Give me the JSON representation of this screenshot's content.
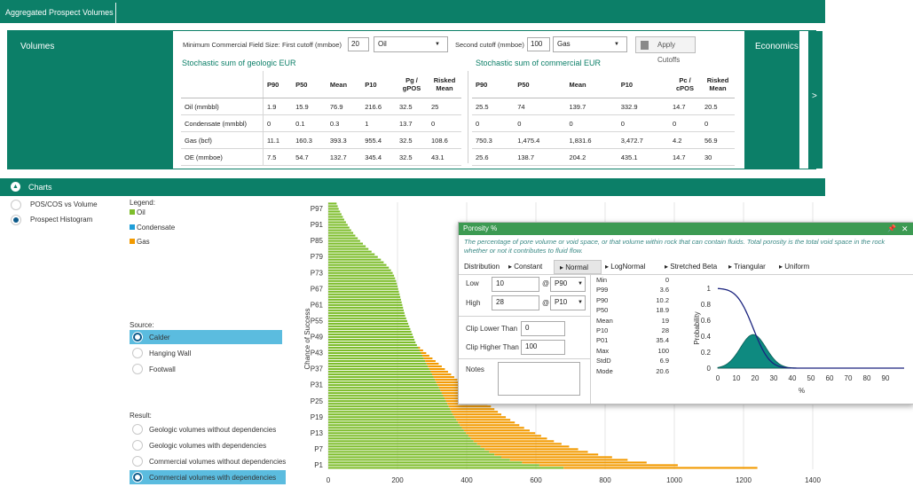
{
  "window": {
    "tab_title": "Aggregated Prospect Volumes"
  },
  "volumes": {
    "title": "Volumes",
    "min_field_label": "Minimum Commercial Field Size:",
    "first_cutoff_label": "First cutoff (mmboe)",
    "first_cutoff_value": "20",
    "first_fluid": "Oil",
    "second_cutoff_label": "Second cutoff (mmboe)",
    "second_cutoff_value": "100",
    "second_fluid": "Gas",
    "apply_label": "Apply Cutoffs",
    "geo_title": "Stochastic sum of geologic EUR",
    "com_title": "Stochastic sum of commercial EUR",
    "geo_headers": [
      "P90",
      "P50",
      "Mean",
      "P10",
      "Pg / gPOS",
      "Risked Mean"
    ],
    "com_headers": [
      "P90",
      "P50",
      "Mean",
      "P10",
      "Pc / cPOS",
      "Risked Mean"
    ],
    "rows": [
      {
        "label": "Oil (mmbbl)",
        "geo": [
          "1.9",
          "15.9",
          "76.9",
          "216.6",
          "32.5",
          "25"
        ],
        "com": [
          "25.5",
          "74",
          "139.7",
          "332.9",
          "14.7",
          "20.5"
        ]
      },
      {
        "label": "Condensate (mmbbl)",
        "geo": [
          "0",
          "0.1",
          "0.3",
          "1",
          "13.7",
          "0"
        ],
        "com": [
          "0",
          "0",
          "0",
          "0",
          "0",
          "0"
        ]
      },
      {
        "label": "Gas (bcf)",
        "geo": [
          "11.1",
          "160.3",
          "393.3",
          "955.4",
          "32.5",
          "108.6"
        ],
        "com": [
          "750.3",
          "1,475.4",
          "1,831.6",
          "3,472.7",
          "4.2",
          "56.9"
        ]
      },
      {
        "label": "OE (mmboe)",
        "geo": [
          "7.5",
          "54.7",
          "132.7",
          "345.4",
          "32.5",
          "43.1"
        ],
        "com": [
          "25.6",
          "138.7",
          "204.2",
          "435.1",
          "14.7",
          "30"
        ]
      }
    ],
    "economics_label": "Economics",
    "economics_chevron": ">"
  },
  "charts": {
    "title": "Charts",
    "types": [
      {
        "label": "POS/COS vs Volume",
        "selected": false
      },
      {
        "label": "Prospect Histogram",
        "selected": true
      }
    ],
    "legend_title": "Legend:",
    "legend": [
      {
        "label": "Oil",
        "color": "#7dbd2b"
      },
      {
        "label": "Condensate",
        "color": "#1f9ed8"
      },
      {
        "label": "Gas",
        "color": "#f29a00"
      }
    ],
    "source_title": "Source:",
    "sources": [
      {
        "label": "Calder",
        "selected": true
      },
      {
        "label": "Hanging Wall",
        "selected": false
      },
      {
        "label": "Footwall",
        "selected": false
      }
    ],
    "result_title": "Result:",
    "results": [
      {
        "label": "Geologic volumes without dependencies",
        "selected": false
      },
      {
        "label": "Geologic volumes with dependencies",
        "selected": false
      },
      {
        "label": "Commercial volumes without dependencies",
        "selected": false
      },
      {
        "label": "Commercial volumes with dependencies",
        "selected": true
      }
    ]
  },
  "chart_data": {
    "type": "bar",
    "orientation": "horizontal",
    "stacked": true,
    "ylabel": "Chance of Success",
    "y_tick_labels": [
      "P97",
      "P91",
      "P85",
      "P79",
      "P73",
      "P67",
      "P61",
      "P55",
      "P49",
      "P43",
      "P37",
      "P31",
      "P25",
      "P19",
      "P13",
      "P7",
      "P1"
    ],
    "xlim": [
      0,
      1400
    ],
    "x_ticks": [
      0,
      200,
      400,
      600,
      800,
      1000,
      1200,
      1400
    ],
    "grid": true,
    "series": [
      {
        "name": "Oil",
        "color": "#7dbd2b",
        "values": [
          24,
          27,
          30,
          34,
          38,
          42,
          46,
          51,
          56,
          61,
          66,
          72,
          78,
          85,
          92,
          100,
          108,
          116,
          125,
          134,
          143,
          152,
          160,
          168,
          175,
          181,
          186,
          190,
          193,
          196,
          198,
          200,
          202,
          204,
          206,
          208,
          210,
          212,
          214,
          216,
          218,
          220,
          222,
          225,
          228,
          231,
          234,
          237,
          240,
          243,
          246,
          249,
          252,
          256,
          260,
          264,
          268,
          272,
          276,
          280,
          284,
          288,
          292,
          296,
          300,
          304,
          308,
          312,
          316,
          320,
          324,
          328,
          332,
          336,
          340,
          344,
          348,
          352,
          356,
          360,
          365,
          370,
          375,
          380,
          386,
          392,
          398,
          405,
          412,
          420,
          430,
          440,
          452,
          465,
          480,
          500,
          525,
          560,
          610,
          680
        ]
      },
      {
        "name": "Gas",
        "color": "#f29a00",
        "values": [
          0,
          0,
          0,
          0,
          0,
          0,
          0,
          0,
          0,
          0,
          0,
          0,
          0,
          0,
          0,
          0,
          0,
          0,
          0,
          0,
          0,
          0,
          0,
          0,
          0,
          0,
          0,
          0,
          0,
          0,
          0,
          0,
          0,
          0,
          0,
          0,
          0,
          0,
          0,
          0,
          0,
          0,
          0,
          0,
          0,
          0,
          0,
          0,
          0,
          0,
          0,
          0,
          0,
          0,
          5,
          10,
          15,
          20,
          25,
          30,
          35,
          40,
          45,
          50,
          55,
          60,
          65,
          70,
          75,
          80,
          86,
          92,
          98,
          104,
          110,
          116,
          122,
          128,
          134,
          140,
          148,
          156,
          164,
          172,
          180,
          190,
          200,
          210,
          220,
          232,
          244,
          256,
          270,
          285,
          300,
          320,
          340,
          360,
          400,
          560
        ]
      }
    ]
  },
  "popup": {
    "title": "Porosity %",
    "pin_icon": "📌",
    "close_icon": "✕",
    "description": "The percentage of pore volume or void space, or that volume within rock that can contain fluids. Total porosity is the total void space in the rock whether or not it contributes to fluid flow.",
    "tabs_label": "Distribution",
    "tabs": [
      "Constant",
      "Normal",
      "LogNormal",
      "Stretched Beta",
      "Triangular",
      "Uniform"
    ],
    "active_tab": "Normal",
    "low_label": "Low",
    "low_value": "10",
    "low_at": "@",
    "low_p": "P90",
    "high_label": "High",
    "high_value": "28",
    "high_at": "@",
    "high_p": "P10",
    "clip_lower_label": "Clip Lower Than",
    "clip_lower_value": "0",
    "clip_higher_label": "Clip Higher Than",
    "clip_higher_value": "100",
    "notes_label": "Notes",
    "stats": [
      {
        "k": "Min",
        "v": "0"
      },
      {
        "k": "P99",
        "v": "3.6"
      },
      {
        "k": "P90",
        "v": "10.2"
      },
      {
        "k": "P50",
        "v": "18.9"
      },
      {
        "k": "Mean",
        "v": "19"
      },
      {
        "k": "P10",
        "v": "28"
      },
      {
        "k": "P01",
        "v": "35.4"
      },
      {
        "k": "Max",
        "v": "100"
      },
      {
        "k": "StdD",
        "v": "6.9"
      },
      {
        "k": "Mode",
        "v": "20.6"
      }
    ],
    "mini_chart": {
      "xlabel": "%",
      "ylabel": "Probability",
      "x_ticks": [
        "0",
        "10",
        "20",
        "30",
        "40",
        "50",
        "60",
        "70",
        "80",
        "90"
      ],
      "y_ticks": [
        "0",
        "0.2",
        "0.4",
        "0.6",
        "0.8",
        "1"
      ],
      "mean": 19,
      "stdev": 6.9,
      "curve_color": "#1a237e",
      "fill_color": "#0e8a80"
    }
  }
}
